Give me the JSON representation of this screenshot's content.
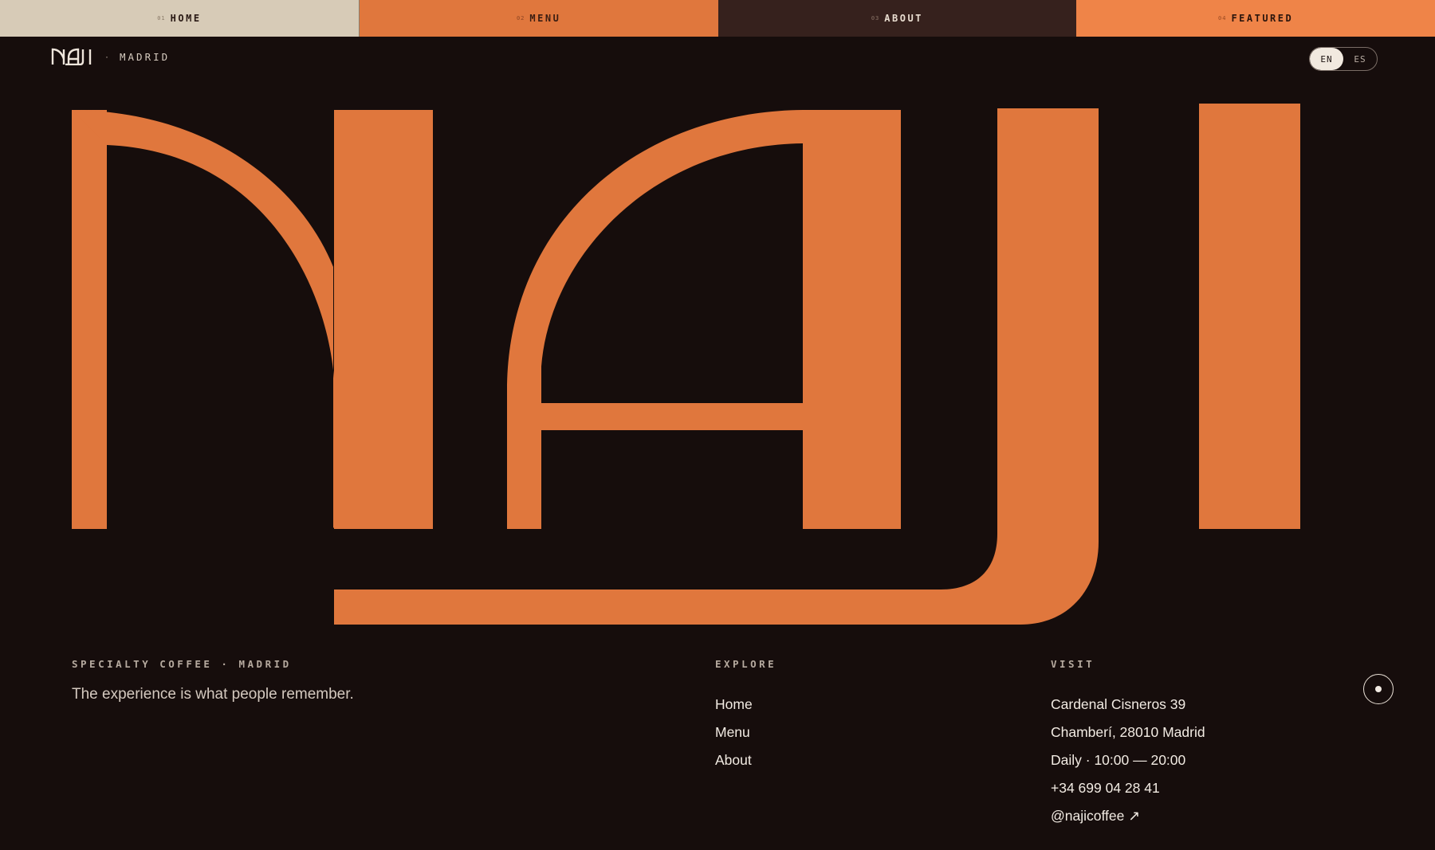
{
  "nav": [
    {
      "num": "01",
      "label": "HOME"
    },
    {
      "num": "02",
      "label": "MENU"
    },
    {
      "num": "03",
      "label": "ABOUT"
    },
    {
      "num": "04",
      "label": "FEATURED"
    }
  ],
  "brand": {
    "separator": "·",
    "city": "MADRID"
  },
  "lang": {
    "active": "EN",
    "other": "ES"
  },
  "footer": {
    "intro": {
      "heading": "SPECIALTY COFFEE · MADRID",
      "tagline": "The experience is what people remember."
    },
    "explore": {
      "heading": "EXPLORE",
      "links": [
        "Home",
        "Menu",
        "About"
      ]
    },
    "visit": {
      "heading": "VISIT",
      "address1": "Cardenal Cisneros 39",
      "address2": "Chamberí, 28010 Madrid",
      "hours": "Daily · 10:00 — 20:00",
      "phone": "+34 699 04 28 41",
      "instagram": "@najicoffee",
      "instagram_arrow": "↗"
    }
  },
  "colors": {
    "background": "#160d0c",
    "accent": "#e0773d",
    "cream": "#d7cbb7",
    "brown": "#36211d"
  },
  "icons": {
    "logo": "naji-logo",
    "small_logo": "naji-small-logo",
    "action": "record-dot-icon"
  }
}
